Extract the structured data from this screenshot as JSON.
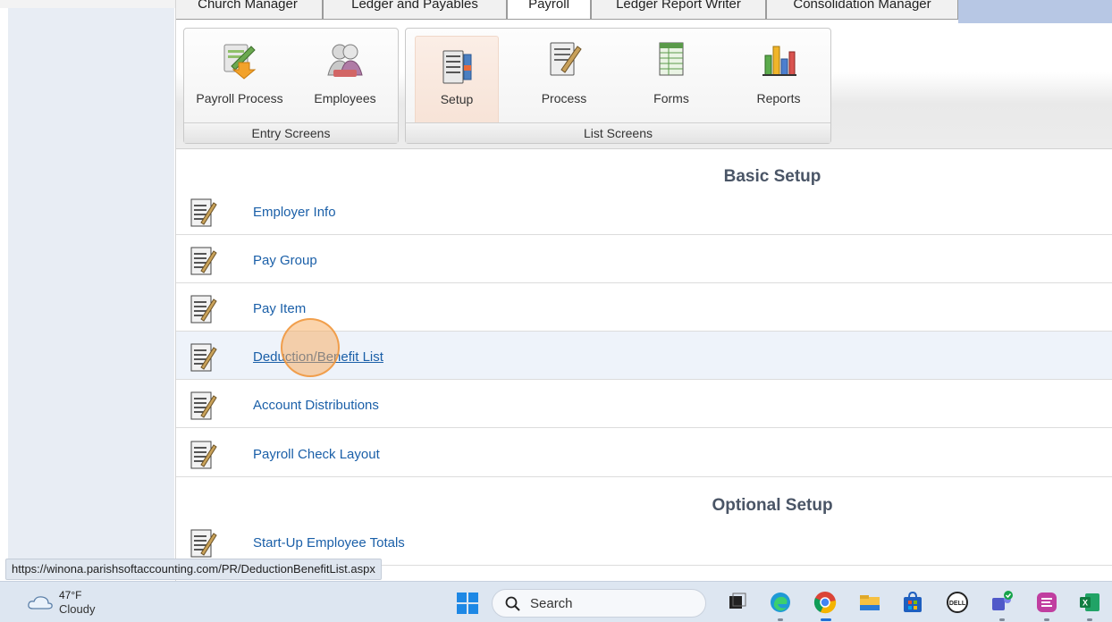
{
  "tabs": [
    {
      "label": "Church Manager"
    },
    {
      "label": "Ledger and Payables"
    },
    {
      "label": "Payroll"
    },
    {
      "label": "Ledger Report Writer"
    },
    {
      "label": "Consolidation Manager"
    }
  ],
  "ribbon": {
    "entry_group_label": "Entry Screens",
    "list_group_label": "List Screens",
    "entry_buttons": [
      {
        "label": "Payroll Process",
        "icon": "payroll-process-icon"
      },
      {
        "label": "Employees",
        "icon": "employees-icon"
      }
    ],
    "list_buttons": [
      {
        "label": "Setup",
        "icon": "setup-icon",
        "active": true
      },
      {
        "label": "Process",
        "icon": "process-icon"
      },
      {
        "label": "Forms",
        "icon": "forms-icon"
      },
      {
        "label": "Reports",
        "icon": "reports-icon"
      }
    ]
  },
  "basic_setup": {
    "title": "Basic Setup",
    "items": [
      {
        "label": "Employer Info"
      },
      {
        "label": "Pay Group"
      },
      {
        "label": "Pay Item"
      },
      {
        "label": "Deduction/Benefit List",
        "hovered": true
      },
      {
        "label": "Account Distributions"
      },
      {
        "label": "Payroll Check Layout"
      }
    ]
  },
  "optional_setup": {
    "title": "Optional Setup",
    "items": [
      {
        "label": "Start-Up Employee Totals"
      }
    ]
  },
  "status_url": "https://winona.parishsoftaccounting.com/PR/DeductionBenefitList.aspx",
  "taskbar": {
    "weather_temp": "47°F",
    "weather_condition": "Cloudy",
    "search_label": "Search"
  },
  "colors": {
    "link": "#1a5fa8",
    "title": "#4a5566",
    "hover_row": "#eef3fa",
    "tab_fill": "#b7c7e4"
  }
}
